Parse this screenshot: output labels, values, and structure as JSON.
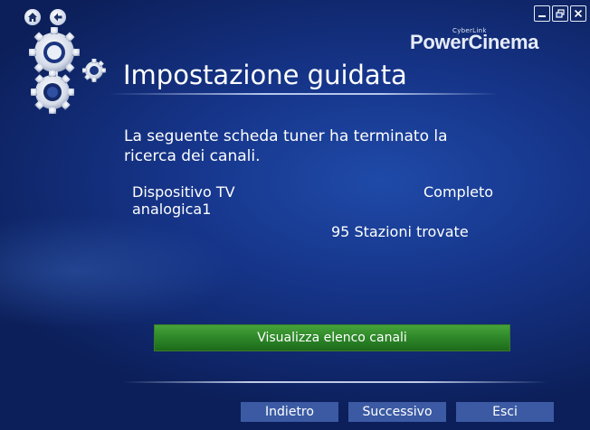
{
  "brand": {
    "small": "CyberLink",
    "name": "PowerCinema"
  },
  "title": "Impostazione guidata",
  "message": "La seguente scheda tuner ha terminato la ricerca dei canali.",
  "device": {
    "name": "Dispositivo TV analogica1",
    "status": "Completo",
    "found": "95 Stazioni trovate"
  },
  "actions": {
    "view_channels": "Visualizza elenco canali"
  },
  "footer": {
    "back": "Indietro",
    "next": "Successivo",
    "exit": "Esci"
  },
  "icons": {
    "home": "home-icon",
    "back": "back-arrow-icon",
    "minimize": "minimize-icon",
    "restore": "restore-icon",
    "close": "close-icon",
    "logo": "gears-icon"
  },
  "colors": {
    "accent_green": "#2f8a2a",
    "footer_button": "#3b5aa3",
    "background": "#16358a"
  }
}
